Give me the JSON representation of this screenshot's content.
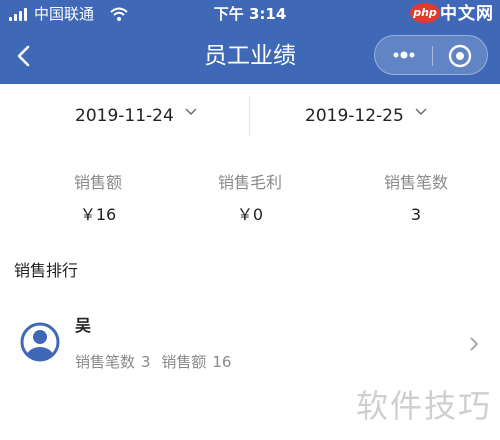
{
  "status_bar": {
    "carrier": "中国联通",
    "time": "下午 3:14",
    "watermark_logo": "php",
    "watermark_text": "中文网"
  },
  "navbar": {
    "title": "员工业绩",
    "icons": [
      "back-icon",
      "more-icon",
      "record-icon"
    ]
  },
  "date_range": {
    "start": "2019-11-24",
    "end": "2019-12-25"
  },
  "stats": [
    {
      "label": "销售额",
      "value": "￥16"
    },
    {
      "label": "销售毛利",
      "value": "￥0"
    },
    {
      "label": "销售笔数",
      "value": "3"
    }
  ],
  "ranking": {
    "title": "销售排行",
    "items": [
      {
        "name": "吴",
        "count_label": "销售笔数",
        "count": "3",
        "amount_label": "销售额",
        "amount": "16"
      }
    ]
  },
  "footer_watermark": "软件技巧",
  "colors": {
    "header": "#3f69b7",
    "text_primary": "#222222",
    "text_secondary": "#8a8a8a",
    "avatar": "#3f69b7"
  }
}
